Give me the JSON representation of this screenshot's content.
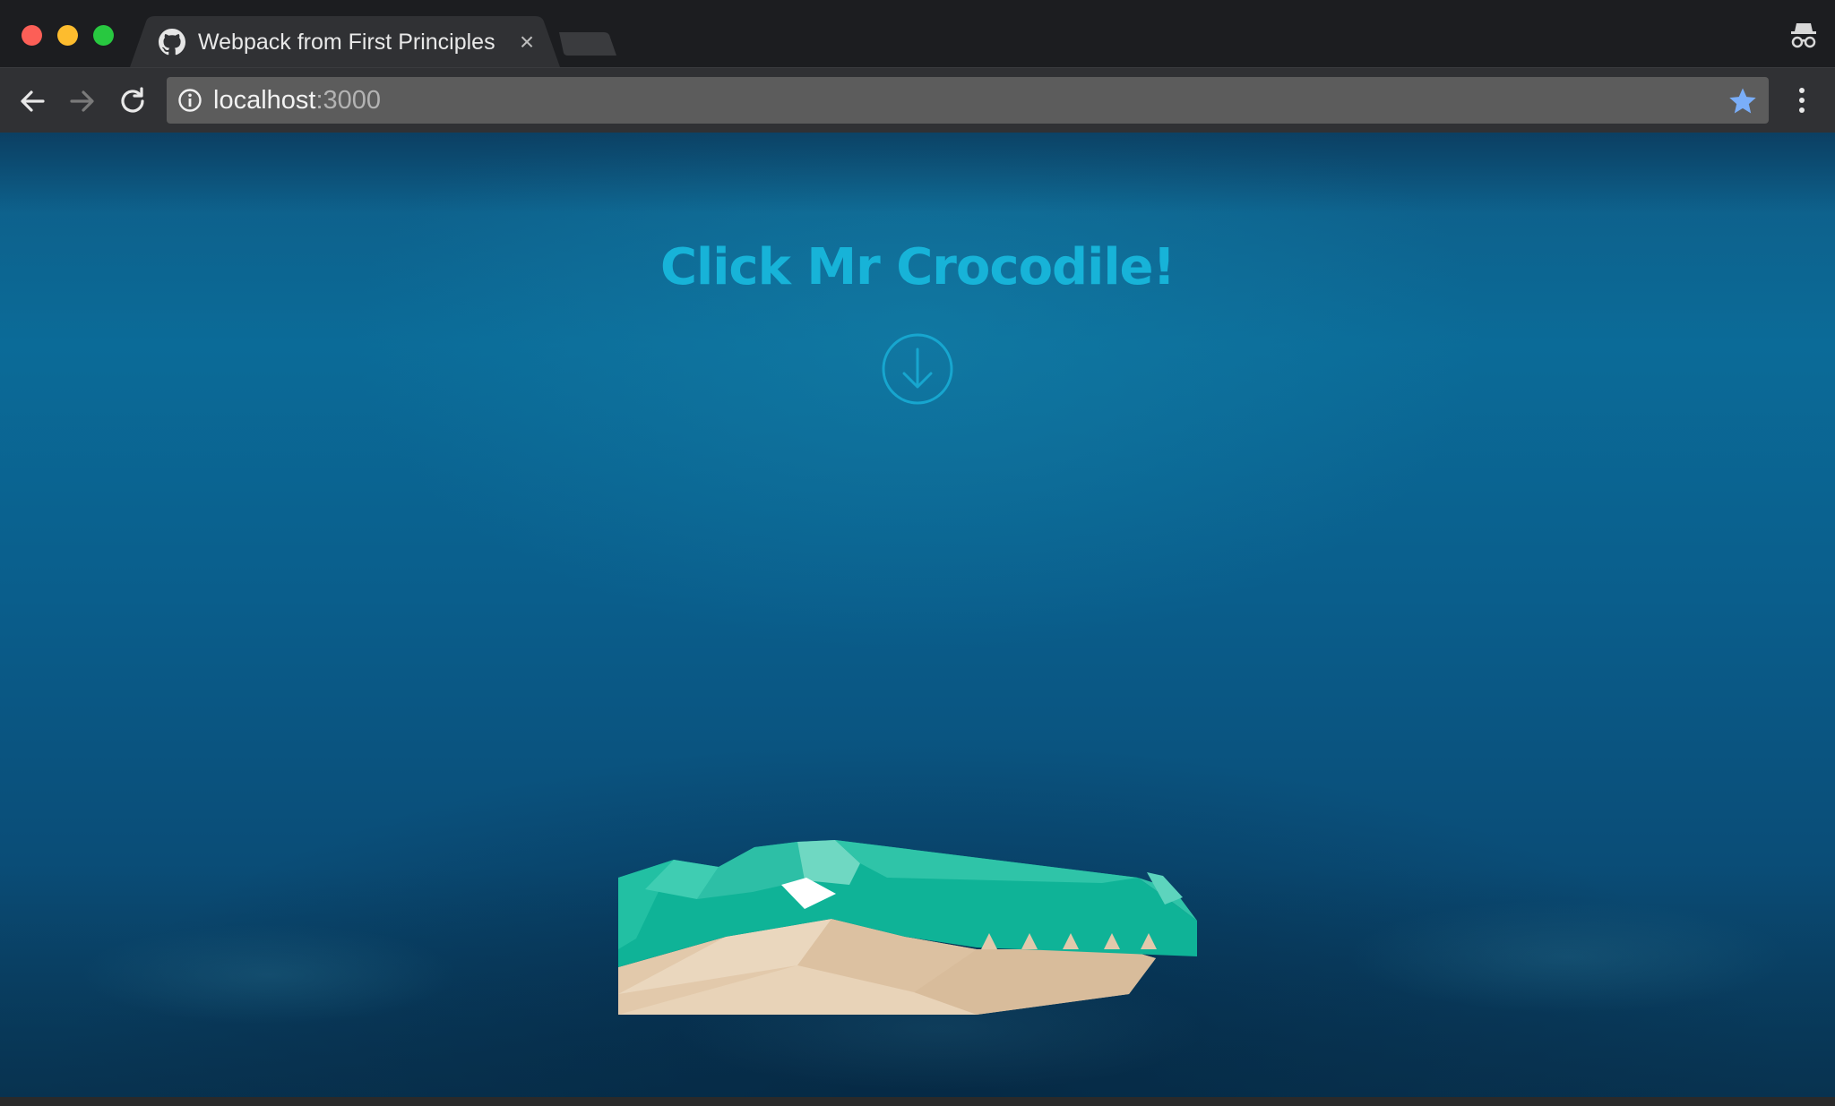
{
  "browser": {
    "tab": {
      "title": "Webpack from First Principles",
      "favicon": "github-icon",
      "close_glyph": "×"
    },
    "address_bar": {
      "host": "localhost",
      "port": ":3000",
      "security_icon": "info-icon",
      "bookmark_icon": "star-icon"
    },
    "toolbar_icons": [
      "arrow-left-icon",
      "arrow-right-icon",
      "reload-icon",
      "menu-icon",
      "incognito-icon"
    ],
    "colors": {
      "close": "#fc5f57",
      "minimize": "#fdbc2e",
      "maximize": "#28c840",
      "bookmark_star": "#7aaef9"
    }
  },
  "page": {
    "headline": "Click Mr Crocodile!",
    "headline_color": "#17b3d8",
    "arrow_icon": "arrow-down-circle-icon",
    "illustration": "crocodile-head-illustration",
    "background": "underwater-ocean"
  }
}
